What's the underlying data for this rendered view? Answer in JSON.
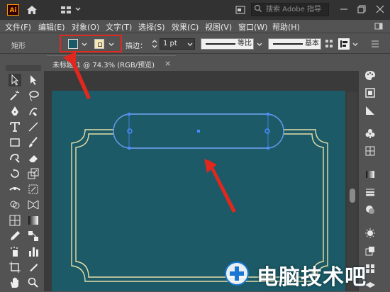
{
  "app": {
    "logo_text": "Ai"
  },
  "search": {
    "placeholder": "搜索 Adobe 指导"
  },
  "menu": {
    "items": [
      "文件(F)",
      "编辑(E)",
      "对象(O)",
      "文字(T)",
      "选择(S)",
      "效果(C)",
      "视图(V)",
      "窗口(W)",
      "帮助(H)"
    ]
  },
  "control": {
    "selection_label": "矩形",
    "fill_color": "#1a5a66",
    "stroke_color": "#f8e8b4",
    "stroke_label": "描边：",
    "stroke_weight": "1 pt",
    "profile_label": "等比",
    "brush_label": "基本"
  },
  "document": {
    "tab_title": "未标题-1 @ 74.3% (RGB/预览)",
    "close": "×"
  },
  "watermark": {
    "text": "电脑技术吧"
  },
  "colors": {
    "artboard": "#1b5a66",
    "frame": "#e8dfa8",
    "selection": "#4a8cff",
    "annotation": "#e0281e"
  }
}
